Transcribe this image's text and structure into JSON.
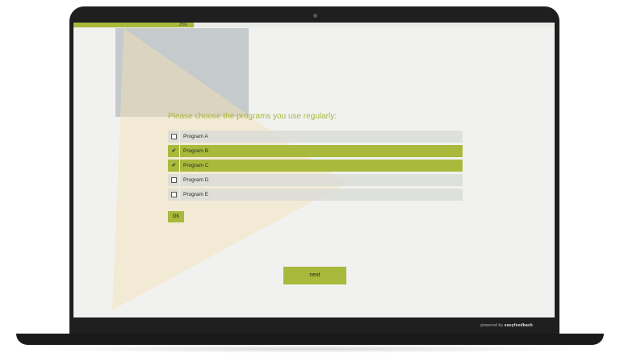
{
  "progress": {
    "label": "25%",
    "value": 0.25
  },
  "question": {
    "text": "Please choose the programs you use regularly:"
  },
  "options": [
    {
      "label": "Program A",
      "selected": false
    },
    {
      "label": "Program B",
      "selected": true
    },
    {
      "label": "Program C",
      "selected": true
    },
    {
      "label": "Program D",
      "selected": false
    },
    {
      "label": "Program E",
      "selected": false
    }
  ],
  "buttons": {
    "ok_label": "OK",
    "next_label": "next"
  },
  "footer": {
    "powered_prefix": "powered by",
    "brand": "easyfeedback"
  },
  "colors": {
    "accent": "#a8b93c",
    "option_bg": "#d7d9d6",
    "screen_bg": "#f1f2f0"
  },
  "icons": {
    "checked": "check-icon",
    "unchecked": "checkbox-icon"
  }
}
